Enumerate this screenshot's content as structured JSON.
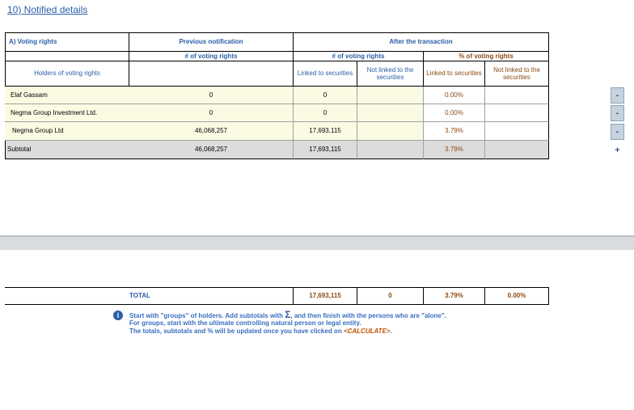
{
  "section_title": "10) Notified details",
  "header": {
    "voting_rights": "A) Voting rights",
    "previous_notification": "Previous notification",
    "after_transaction": "After the transaction",
    "num_voting_rights_prev": "# of voting rights",
    "num_voting_rights_after": "# of voting rights",
    "pct_voting_rights": "% of voting rights",
    "holders": "Holders of voting rights",
    "linked": "Linked to securities",
    "not_linked": "Not linked to the securities",
    "pct_linked": "Linked to securities",
    "pct_not_linked": "Not linked to the securities"
  },
  "rows": [
    {
      "holder": "Elaf Gassam",
      "previous": "0",
      "linked": "0",
      "not_linked": "",
      "pct_linked": "0.00%",
      "pct_not_linked": "",
      "button": "-"
    },
    {
      "holder": "Negma Group Investment Ltd.",
      "previous": "0",
      "linked": "0",
      "not_linked": "",
      "pct_linked": "0.00%",
      "pct_not_linked": "",
      "button": "-"
    },
    {
      "holder": "Negma Group Ltd",
      "previous": "46,068,257",
      "linked": "17,693,115",
      "not_linked": "",
      "pct_linked": "3.79%",
      "pct_not_linked": "",
      "button": "-"
    }
  ],
  "subtotal": {
    "label": "Subtotal",
    "previous": "46,068,257",
    "linked": "17,693,115",
    "not_linked": "",
    "pct_linked": "3.79%",
    "pct_not_linked": "",
    "button": "+"
  },
  "total": {
    "label": "TOTAL",
    "linked": "17,693,115",
    "not_linked": "0",
    "pct_linked": "3.79%",
    "pct_not_linked": "0.00%"
  },
  "notes": {
    "line1_a": "Start with \"groups\" of holders. Add subtotals with",
    "sigma": "Σ",
    "line1_b": ", and then finish with the persons who are \"alone\".",
    "line2": "For groups, start with the ultimate controlling natural person or legal entity.",
    "line3_a": "The totals, subtotals and % will be updated once you have clicked on ",
    "calculate": "<CALCULATE>",
    "line3_b": "."
  }
}
